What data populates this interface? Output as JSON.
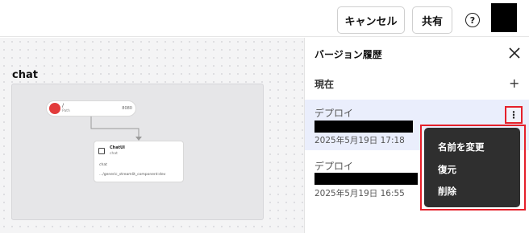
{
  "toolbar": {
    "cancel_label": "キャンセル",
    "share_label": "共有",
    "help_symbol": "?"
  },
  "canvas": {
    "group_title": "chat",
    "node_route": {
      "title": "/",
      "subtitle": "Path",
      "port": "8080"
    },
    "node_chat": {
      "title": "ChatUI",
      "subtitle": "chat",
      "name": "chat",
      "path": ".../generic_streamlit_component:dev"
    }
  },
  "panel": {
    "title": "バージョン履歴",
    "current_label": "現在",
    "versions": [
      {
        "title": "デプロイ",
        "date": "2025年5月19日 17:18"
      },
      {
        "title": "デプロイ",
        "date": "2025年5月19日 16:55"
      }
    ],
    "menu": {
      "items": [
        "名前を変更",
        "復元",
        "削除"
      ]
    },
    "kebab_symbol": "⋮",
    "plus_symbol": "+"
  },
  "colors": {
    "accent_selected": "#eaeefc",
    "highlight_outline": "#e5202a",
    "menu_bg": "#2f2f2f"
  }
}
